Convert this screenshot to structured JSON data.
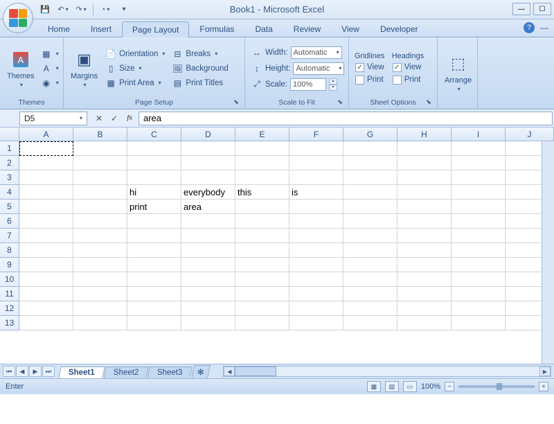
{
  "app": {
    "title": "Book1 - Microsoft Excel"
  },
  "tabs": {
    "home": "Home",
    "insert": "Insert",
    "pagelayout": "Page Layout",
    "formulas": "Formulas",
    "data": "Data",
    "review": "Review",
    "view": "View",
    "developer": "Developer",
    "active": "pagelayout"
  },
  "ribbon": {
    "themes": {
      "label": "Themes",
      "btn_themes": "Themes"
    },
    "page_setup": {
      "label": "Page Setup",
      "margins": "Margins",
      "orientation": "Orientation",
      "size": "Size",
      "print_area": "Print Area",
      "breaks": "Breaks",
      "background": "Background",
      "print_titles": "Print Titles"
    },
    "scale": {
      "label": "Scale to Fit",
      "width_lbl": "Width:",
      "width_val": "Automatic",
      "height_lbl": "Height:",
      "height_val": "Automatic",
      "scale_lbl": "Scale:",
      "scale_val": "100%"
    },
    "sheet_options": {
      "label": "Sheet Options",
      "gridlines": "Gridlines",
      "headings": "Headings",
      "view": "View",
      "print": "Print"
    },
    "arrange": {
      "label": "Arrange",
      "btn": "Arrange"
    }
  },
  "formula_bar": {
    "name_box": "D5",
    "value": "area"
  },
  "columns": [
    "A",
    "B",
    "C",
    "D",
    "E",
    "F",
    "G",
    "H",
    "I",
    "J"
  ],
  "rows": [
    "1",
    "2",
    "3",
    "4",
    "5",
    "6",
    "7",
    "8",
    "9",
    "10",
    "11",
    "12",
    "13"
  ],
  "cells": {
    "r4": {
      "C": "hi",
      "D": "everybody",
      "E": "this",
      "F": "is"
    },
    "r5": {
      "C": "print",
      "D": "area"
    }
  },
  "sheets": {
    "s1": "Sheet1",
    "s2": "Sheet2",
    "s3": "Sheet3"
  },
  "status": {
    "mode": "Enter",
    "zoom": "100%"
  }
}
